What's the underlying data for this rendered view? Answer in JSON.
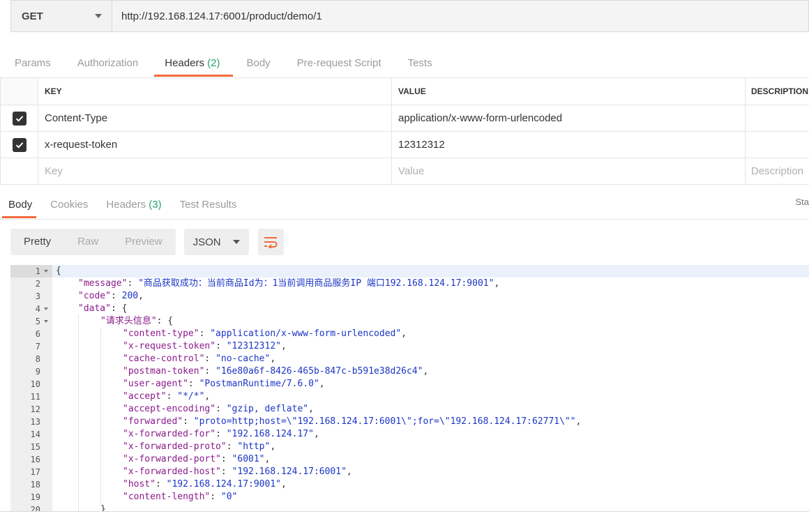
{
  "request": {
    "method": "GET",
    "url": "http://192.168.124.17:6001/product/demo/1"
  },
  "request_tabs": [
    {
      "label": "Params",
      "count": ""
    },
    {
      "label": "Authorization",
      "count": ""
    },
    {
      "label": "Headers",
      "count": "(2)"
    },
    {
      "label": "Body",
      "count": ""
    },
    {
      "label": "Pre-request Script",
      "count": ""
    },
    {
      "label": "Tests",
      "count": ""
    }
  ],
  "headers_table": {
    "columns": [
      "KEY",
      "VALUE",
      "DESCRIPTION"
    ],
    "rows": [
      {
        "key": "Content-Type",
        "value": "application/x-www-form-urlencoded",
        "checked": true
      },
      {
        "key": "x-request-token",
        "value": "12312312",
        "checked": true
      }
    ],
    "placeholders": {
      "key": "Key",
      "value": "Value",
      "description": "Description"
    }
  },
  "response_tabs": [
    {
      "label": "Body",
      "count": ""
    },
    {
      "label": "Cookies",
      "count": ""
    },
    {
      "label": "Headers",
      "count": "(3)"
    },
    {
      "label": "Test Results",
      "count": ""
    }
  ],
  "status_partial": "Sta",
  "view_modes": [
    "Pretty",
    "Raw",
    "Preview"
  ],
  "format": "JSON",
  "code_lines": [
    {
      "n": "1",
      "fold": true,
      "indent": 0,
      "tokens": [
        [
          "p",
          "{"
        ]
      ]
    },
    {
      "n": "2",
      "fold": false,
      "indent": 1,
      "tokens": [
        [
          "k",
          "\"message\""
        ],
        [
          "p",
          ": "
        ],
        [
          "s",
          "\"商品获取成功：当前商品Id为：1当前调用商品服务IP 端口192.168.124.17:9001\""
        ],
        [
          "p",
          ","
        ]
      ]
    },
    {
      "n": "3",
      "fold": false,
      "indent": 1,
      "tokens": [
        [
          "k",
          "\"code\""
        ],
        [
          "p",
          ": "
        ],
        [
          "n",
          "200"
        ],
        [
          "p",
          ","
        ]
      ]
    },
    {
      "n": "4",
      "fold": true,
      "indent": 1,
      "tokens": [
        [
          "k",
          "\"data\""
        ],
        [
          "p",
          ": {"
        ]
      ]
    },
    {
      "n": "5",
      "fold": true,
      "indent": 2,
      "tokens": [
        [
          "k",
          "\"请求头信息\""
        ],
        [
          "p",
          ": {"
        ]
      ]
    },
    {
      "n": "6",
      "fold": false,
      "indent": 3,
      "tokens": [
        [
          "k",
          "\"content-type\""
        ],
        [
          "p",
          ": "
        ],
        [
          "s",
          "\"application/x-www-form-urlencoded\""
        ],
        [
          "p",
          ","
        ]
      ]
    },
    {
      "n": "7",
      "fold": false,
      "indent": 3,
      "tokens": [
        [
          "k",
          "\"x-request-token\""
        ],
        [
          "p",
          ": "
        ],
        [
          "s",
          "\"12312312\""
        ],
        [
          "p",
          ","
        ]
      ]
    },
    {
      "n": "8",
      "fold": false,
      "indent": 3,
      "tokens": [
        [
          "k",
          "\"cache-control\""
        ],
        [
          "p",
          ": "
        ],
        [
          "s",
          "\"no-cache\""
        ],
        [
          "p",
          ","
        ]
      ]
    },
    {
      "n": "9",
      "fold": false,
      "indent": 3,
      "tokens": [
        [
          "k",
          "\"postman-token\""
        ],
        [
          "p",
          ": "
        ],
        [
          "s",
          "\"16e80a6f-8426-465b-847c-b591e38d26c4\""
        ],
        [
          "p",
          ","
        ]
      ]
    },
    {
      "n": "10",
      "fold": false,
      "indent": 3,
      "tokens": [
        [
          "k",
          "\"user-agent\""
        ],
        [
          "p",
          ": "
        ],
        [
          "s",
          "\"PostmanRuntime/7.6.0\""
        ],
        [
          "p",
          ","
        ]
      ]
    },
    {
      "n": "11",
      "fold": false,
      "indent": 3,
      "tokens": [
        [
          "k",
          "\"accept\""
        ],
        [
          "p",
          ": "
        ],
        [
          "s",
          "\"*/*\""
        ],
        [
          "p",
          ","
        ]
      ]
    },
    {
      "n": "12",
      "fold": false,
      "indent": 3,
      "tokens": [
        [
          "k",
          "\"accept-encoding\""
        ],
        [
          "p",
          ": "
        ],
        [
          "s",
          "\"gzip, deflate\""
        ],
        [
          "p",
          ","
        ]
      ]
    },
    {
      "n": "13",
      "fold": false,
      "indent": 3,
      "tokens": [
        [
          "k",
          "\"forwarded\""
        ],
        [
          "p",
          ": "
        ],
        [
          "s",
          "\"proto=http;host=\\\"192.168.124.17:6001\\\";for=\\\"192.168.124.17:62771\\\"\""
        ],
        [
          "p",
          ","
        ]
      ]
    },
    {
      "n": "14",
      "fold": false,
      "indent": 3,
      "tokens": [
        [
          "k",
          "\"x-forwarded-for\""
        ],
        [
          "p",
          ": "
        ],
        [
          "s",
          "\"192.168.124.17\""
        ],
        [
          "p",
          ","
        ]
      ]
    },
    {
      "n": "15",
      "fold": false,
      "indent": 3,
      "tokens": [
        [
          "k",
          "\"x-forwarded-proto\""
        ],
        [
          "p",
          ": "
        ],
        [
          "s",
          "\"http\""
        ],
        [
          "p",
          ","
        ]
      ]
    },
    {
      "n": "16",
      "fold": false,
      "indent": 3,
      "tokens": [
        [
          "k",
          "\"x-forwarded-port\""
        ],
        [
          "p",
          ": "
        ],
        [
          "s",
          "\"6001\""
        ],
        [
          "p",
          ","
        ]
      ]
    },
    {
      "n": "17",
      "fold": false,
      "indent": 3,
      "tokens": [
        [
          "k",
          "\"x-forwarded-host\""
        ],
        [
          "p",
          ": "
        ],
        [
          "s",
          "\"192.168.124.17:6001\""
        ],
        [
          "p",
          ","
        ]
      ]
    },
    {
      "n": "18",
      "fold": false,
      "indent": 3,
      "tokens": [
        [
          "k",
          "\"host\""
        ],
        [
          "p",
          ": "
        ],
        [
          "s",
          "\"192.168.124.17:9001\""
        ],
        [
          "p",
          ","
        ]
      ]
    },
    {
      "n": "19",
      "fold": false,
      "indent": 3,
      "tokens": [
        [
          "k",
          "\"content-length\""
        ],
        [
          "p",
          ": "
        ],
        [
          "s",
          "\"0\""
        ]
      ]
    },
    {
      "n": "20",
      "fold": false,
      "indent": 2,
      "tokens": [
        [
          "p",
          "}"
        ]
      ]
    }
  ],
  "colors": {
    "accent": "#f26b3a",
    "count": "#29a36a",
    "json_key": "#8b1a8b",
    "json_string": "#1b35c6"
  },
  "icons": {
    "method_dropdown": "chevron-down-icon",
    "checkbox": "checkmark-icon",
    "wrap": "wrap-lines-icon"
  }
}
